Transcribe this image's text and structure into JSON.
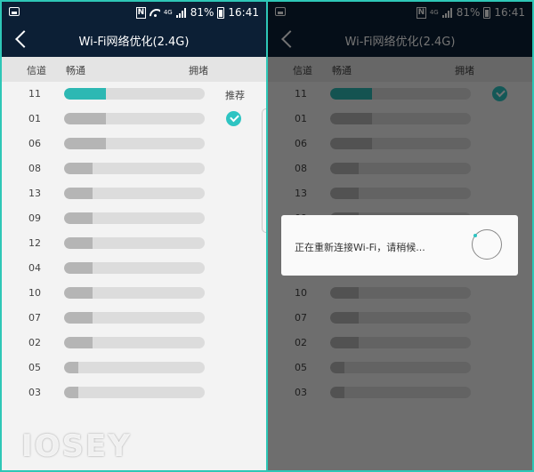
{
  "status_bar": {
    "battery": "81%",
    "time": "16:41",
    "network": "4G",
    "nfc": "N"
  },
  "title": "Wi-Fi网络优化(2.4G)",
  "columns": {
    "channel": "信道",
    "smooth": "畅通",
    "congested": "拥堵"
  },
  "recommend_label": "推荐",
  "accent_color": "#2ec4c2",
  "channels": [
    {
      "channel": "11",
      "fill": 0.3
    },
    {
      "channel": "01",
      "fill": 0.3
    },
    {
      "channel": "06",
      "fill": 0.3
    },
    {
      "channel": "08",
      "fill": 0.2
    },
    {
      "channel": "13",
      "fill": 0.2
    },
    {
      "channel": "09",
      "fill": 0.2
    },
    {
      "channel": "12",
      "fill": 0.2
    },
    {
      "channel": "04",
      "fill": 0.2
    },
    {
      "channel": "10",
      "fill": 0.2
    },
    {
      "channel": "07",
      "fill": 0.2
    },
    {
      "channel": "02",
      "fill": 0.2
    },
    {
      "channel": "05",
      "fill": 0.1
    },
    {
      "channel": "03",
      "fill": 0.1
    }
  ],
  "dialog": {
    "message": "正在重新连接Wi-Fi，请稍候..."
  },
  "watermark": "IOSEY"
}
